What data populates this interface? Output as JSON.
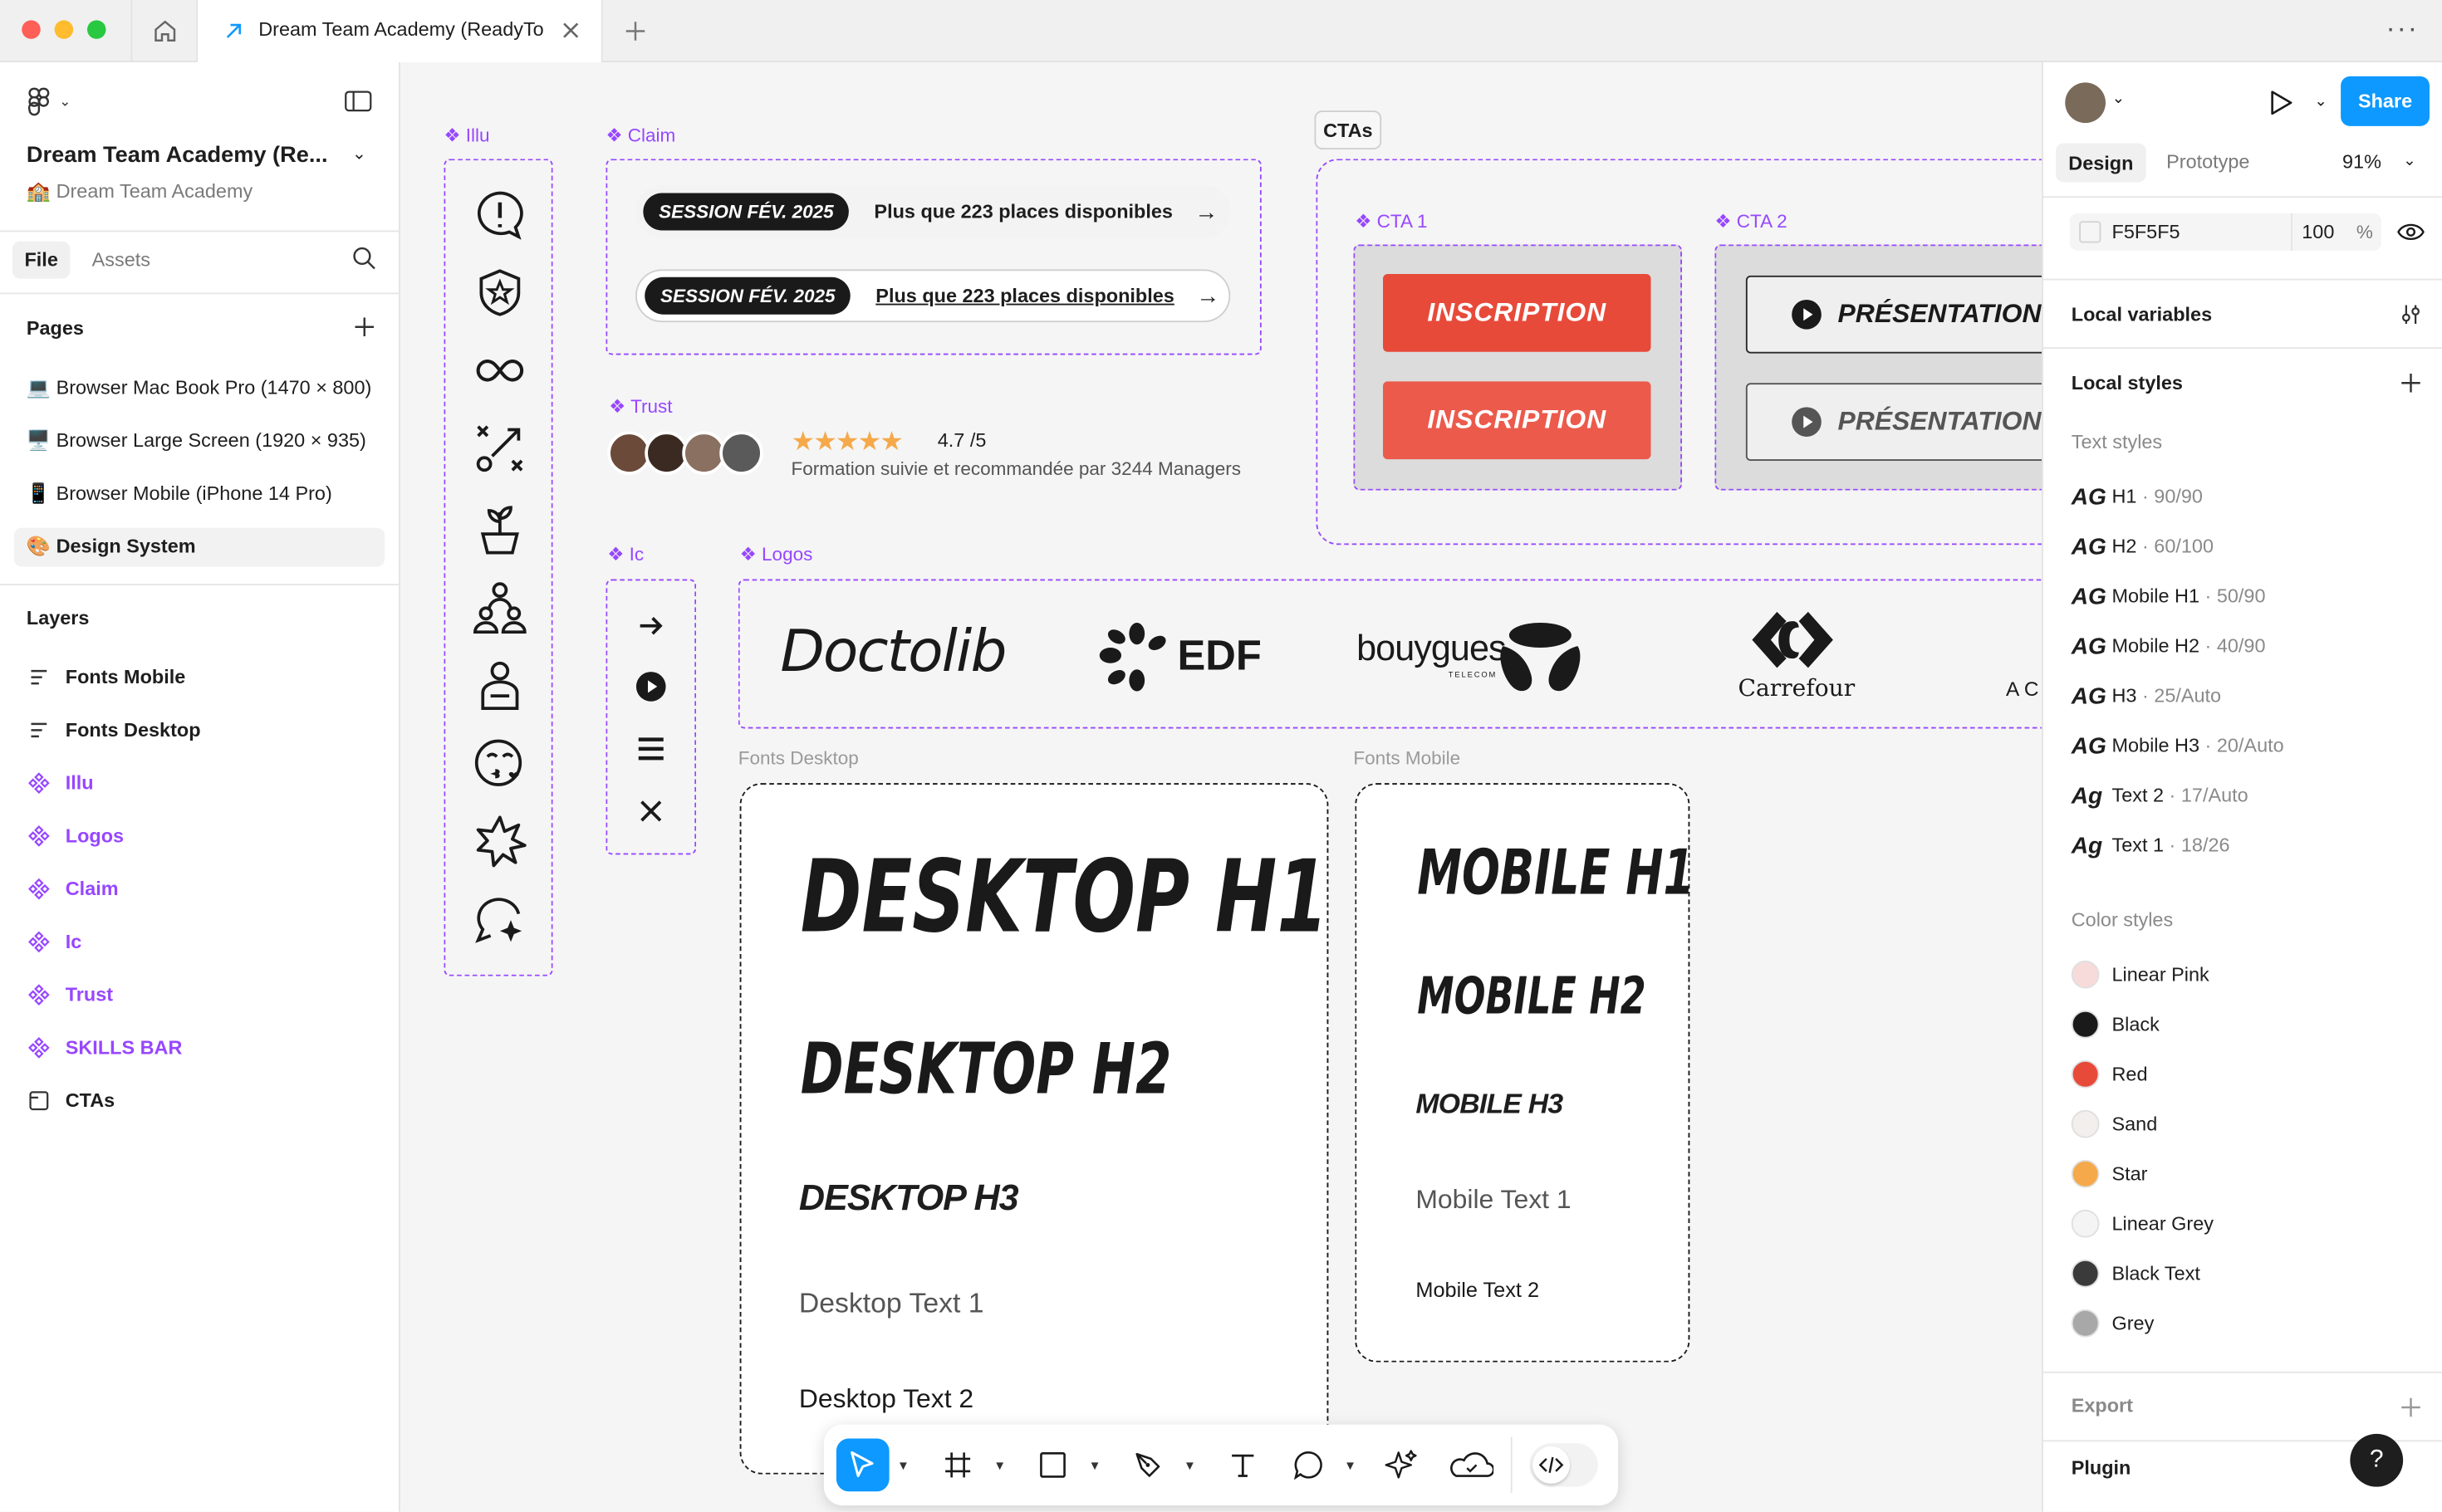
{
  "window": {
    "tab_title": "Dream Team Academy (ReadyTo"
  },
  "left_panel": {
    "file_name": "Dream Team Academy (Re...",
    "team": "🏫 Dream Team Academy",
    "tabs": [
      "File",
      "Assets"
    ],
    "pages_title": "Pages",
    "pages": [
      "💻 Browser Mac Book Pro (1470 × 800)",
      "🖥️ Browser Large Screen (1920 × 935)",
      "📱 Browser Mobile (iPhone 14 Pro)",
      "🎨 Design System"
    ],
    "layers_title": "Layers",
    "layers": [
      {
        "label": "Fonts Mobile",
        "kind": "text"
      },
      {
        "label": "Fonts Desktop",
        "kind": "text"
      },
      {
        "label": "Illu",
        "kind": "component"
      },
      {
        "label": "Logos",
        "kind": "component"
      },
      {
        "label": "Claim",
        "kind": "component"
      },
      {
        "label": "Ic",
        "kind": "component"
      },
      {
        "label": "Trust",
        "kind": "component"
      },
      {
        "label": "SKILLS BAR",
        "kind": "component"
      },
      {
        "label": "CTAs",
        "kind": "frame"
      }
    ]
  },
  "canvas": {
    "labels": {
      "illu": "❖ Illu",
      "claim": "❖ Claim",
      "trust": "❖ Trust",
      "ic": "❖ Ic",
      "logos": "❖ Logos",
      "ctas": "CTAs",
      "cta1": "❖ CTA 1",
      "cta2": "❖ CTA 2",
      "fonts_desktop": "Fonts Desktop",
      "fonts_mobile": "Fonts Mobile"
    },
    "claim": {
      "session": "SESSION FÉV. 2025",
      "places": "Plus que 223 places disponibles"
    },
    "trust": {
      "rating": "4.7 /5",
      "text": "Formation suivie et recommandée par 3244 Managers",
      "stars": 5
    },
    "cta": {
      "inscription": "INSCRIPTION",
      "presentation": "PRÉSENTATION"
    },
    "logos": [
      "Doctolib",
      "EDF",
      "bouygues",
      "TELECOM",
      "Carrefour",
      "AC"
    ],
    "fonts_desktop": [
      "DESKTOP H1",
      "DESKTOP H2",
      "DESKTOP H3",
      "Desktop Text 1",
      "Desktop Text 2"
    ],
    "fonts_mobile": [
      "MOBILE H1",
      "MOBILE H2",
      "MOBILE H3",
      "Mobile Text 1",
      "Mobile Text 2"
    ]
  },
  "right_panel": {
    "share": "Share",
    "tabs": [
      "Design",
      "Prototype"
    ],
    "zoom": "91%",
    "fill": {
      "hex": "F5F5F5",
      "opacity": "100",
      "unit": "%"
    },
    "local_variables": "Local variables",
    "local_styles": "Local styles",
    "text_styles_title": "Text styles",
    "text_styles": [
      {
        "glyph": "AG",
        "name": "H1",
        "meta": " · 90/90"
      },
      {
        "glyph": "AG",
        "name": "H2",
        "meta": " · 60/100"
      },
      {
        "glyph": "AG",
        "name": "Mobile H1",
        "meta": " · 50/90"
      },
      {
        "glyph": "AG",
        "name": "Mobile H2",
        "meta": " · 40/90"
      },
      {
        "glyph": "AG",
        "name": "H3",
        "meta": " · 25/Auto"
      },
      {
        "glyph": "AG",
        "name": "Mobile H3",
        "meta": " · 20/Auto"
      },
      {
        "glyph": "Ag",
        "name": "Text 2",
        "meta": " · 17/Auto"
      },
      {
        "glyph": "Ag",
        "name": "Text 1",
        "meta": " · 18/26"
      }
    ],
    "color_styles_title": "Color styles",
    "color_styles": [
      {
        "name": "Linear Pink",
        "color": "#f7dada"
      },
      {
        "name": "Black",
        "color": "#1a1a1a"
      },
      {
        "name": "Red",
        "color": "#e84a3a"
      },
      {
        "name": "Sand",
        "color": "#f2efec"
      },
      {
        "name": "Star",
        "color": "#f5a94a"
      },
      {
        "name": "Linear Grey",
        "color": "#f4f4f4"
      },
      {
        "name": "Black Text",
        "color": "#3a3a3a"
      },
      {
        "name": "Grey",
        "color": "#a8a8a8"
      }
    ],
    "export": "Export",
    "plugin": "Plugin",
    "help": "?"
  },
  "colors": {
    "accent": "#0d99ff",
    "component": "#9747ff",
    "red": "#e84a3a"
  }
}
